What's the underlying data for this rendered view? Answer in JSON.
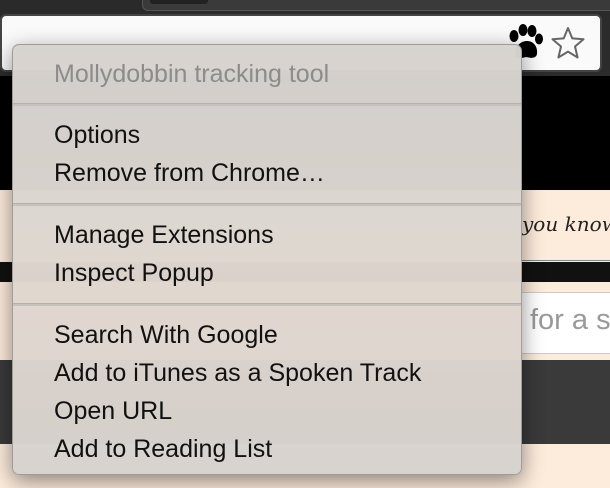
{
  "background": {
    "page_text_1": "you know",
    "search_placeholder": "for a s"
  },
  "menu": {
    "title": "Mollydobbin tracking tool",
    "group1": [
      "Options",
      "Remove from Chrome…"
    ],
    "group2": [
      "Manage Extensions",
      "Inspect Popup"
    ],
    "group3": [
      "Search With Google",
      "Add to iTunes as a Spoken Track",
      "Open URL",
      "Add to Reading List"
    ]
  },
  "icons": {
    "extension": "paw-icon",
    "bookmark": "star-icon"
  },
  "colors": {
    "menu_bg": "#d8d3ce",
    "page_peach": "#fdebdb",
    "disabled_text": "#8c8c8c"
  }
}
